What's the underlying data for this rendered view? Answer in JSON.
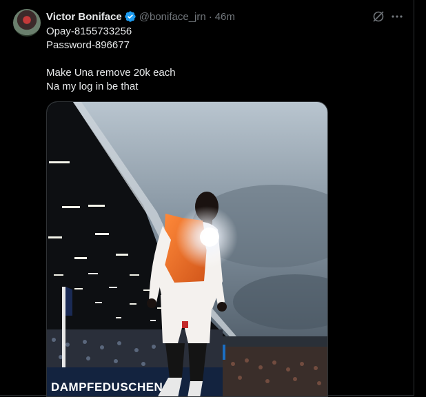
{
  "tweet": {
    "author_name": "Victor Boniface",
    "handle": "@boniface_jrn",
    "separator": "·",
    "time": "46m",
    "text_lines": [
      "Opay-8155733256",
      "Password-896677",
      "",
      "Make Una remove 20k each",
      "Na my log in be that"
    ]
  },
  "media": {
    "banner_text": "DAMPFEDUSCHEN"
  },
  "colors": {
    "background": "#000000",
    "text": "#e7e9ea",
    "muted": "#71767b",
    "verified": "#1d9bf0",
    "border": "#2f3336"
  },
  "icons": {
    "verified": "verified-badge-icon",
    "grok": "grok-icon",
    "more": "more-icon"
  }
}
